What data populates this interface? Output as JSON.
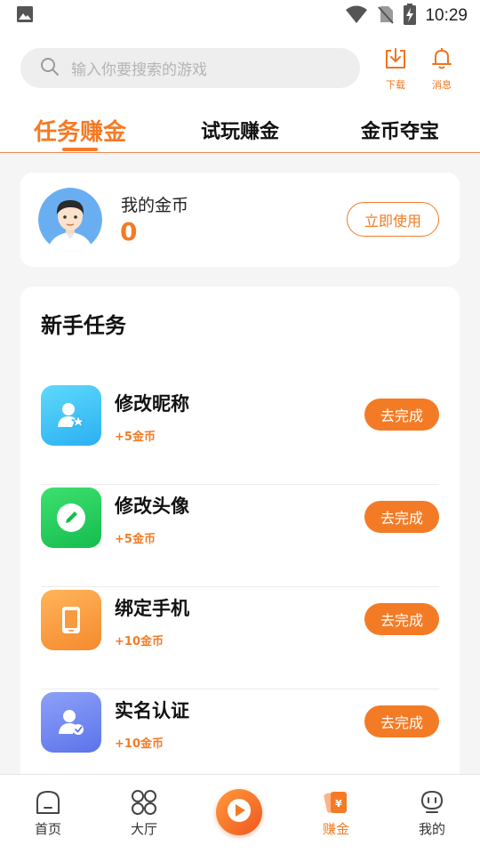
{
  "status_bar": {
    "time": "10:29",
    "icons": [
      "image-icon",
      "wifi-icon",
      "no-sim-icon",
      "battery-charging-icon"
    ]
  },
  "header": {
    "search": {
      "placeholder": "输入你要搜索的游戏",
      "icon": "search-icon"
    },
    "download_label": "下载",
    "messages_label": "消息"
  },
  "tabs": [
    {
      "label": "任务赚金",
      "active": true
    },
    {
      "label": "试玩赚金",
      "active": false
    },
    {
      "label": "金币夺宝",
      "active": false
    }
  ],
  "coins": {
    "label": "我的金币",
    "value": "0",
    "use_button": "立即使用"
  },
  "newbie_tasks": {
    "title": "新手任务",
    "items": [
      {
        "name": "修改昵称",
        "reward": "+5金币",
        "button": "去完成",
        "icon": "user-star-icon",
        "color": "#3fc4f7"
      },
      {
        "name": "修改头像",
        "reward": "+5金币",
        "button": "去完成",
        "icon": "edit-pencil-icon",
        "color": "#22c85a"
      },
      {
        "name": "绑定手机",
        "reward": "+10金币",
        "button": "去完成",
        "icon": "phone-icon",
        "color": "#f99a3a"
      },
      {
        "name": "实名认证",
        "reward": "+10金币",
        "button": "去完成",
        "icon": "user-verified-icon",
        "color": "#6f86f0"
      }
    ]
  },
  "bottom_nav": [
    {
      "label": "首页",
      "icon": "home-icon",
      "active": false
    },
    {
      "label": "大厅",
      "icon": "grid-circles-icon",
      "active": false
    },
    {
      "label": "",
      "icon": "play-icon",
      "active": false
    },
    {
      "label": "赚金",
      "icon": "earn-coin-icon",
      "active": true
    },
    {
      "label": "我的",
      "icon": "robot-face-icon",
      "active": false
    }
  ],
  "colors": {
    "accent": "#f47b25",
    "background": "#f5f5f5"
  }
}
